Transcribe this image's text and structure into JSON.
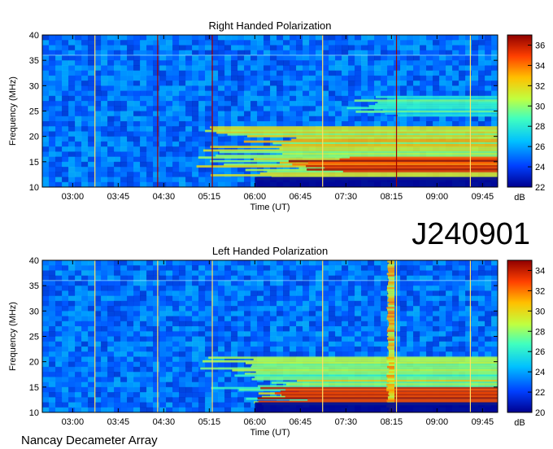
{
  "figure_id": "J240901",
  "footer": "Nancay Decameter Array",
  "chart_data": [
    {
      "type": "heatmap",
      "title": "Right Handed Polarization",
      "xlabel": "Time (UT)",
      "ylabel": "Frequency (MHz)",
      "x_ticks": [
        "03:00",
        "03:45",
        "04:30",
        "05:15",
        "06:00",
        "06:45",
        "07:30",
        "08:15",
        "09:00",
        "09:45"
      ],
      "x_range": [
        "02:30",
        "10:00"
      ],
      "y_ticks": [
        10,
        15,
        20,
        25,
        30,
        35,
        40
      ],
      "ylim": [
        10,
        40
      ],
      "colorbar": {
        "label": "dB",
        "min": 22,
        "max": 37,
        "ticks": [
          22,
          24,
          26,
          28,
          30,
          32,
          34,
          36
        ]
      },
      "colormap": [
        "#00008f",
        "#0040ff",
        "#00c0ff",
        "#40ffbf",
        "#c0ff40",
        "#ffc000",
        "#ff4000",
        "#8f0000"
      ],
      "background_level_db": 25,
      "vertical_lines_ut": [
        "03:22",
        "04:24",
        "05:18",
        "07:07",
        "08:20",
        "09:33"
      ],
      "emission": [
        {
          "band_mhz": [
            11.5,
            22
          ],
          "from_ut": "05:00",
          "to_ut": "10:00",
          "level_db": 31
        },
        {
          "band_mhz": [
            13,
            16
          ],
          "from_ut": "06:30",
          "to_ut": "10:00",
          "level_db": 36
        },
        {
          "band_mhz": [
            24,
            28
          ],
          "from_ut": "07:30",
          "to_ut": "10:00",
          "level_db": 28
        }
      ]
    },
    {
      "type": "heatmap",
      "title": "Left Handed Polarization",
      "xlabel": "Time (UT)",
      "ylabel": "Frequency (MHz)",
      "x_ticks": [
        "03:00",
        "03:45",
        "04:30",
        "05:15",
        "06:00",
        "06:45",
        "07:30",
        "08:15",
        "09:00",
        "09:45"
      ],
      "x_range": [
        "02:30",
        "10:00"
      ],
      "y_ticks": [
        10,
        15,
        20,
        25,
        30,
        35,
        40
      ],
      "ylim": [
        10,
        40
      ],
      "colorbar": {
        "label": "dB",
        "min": 20,
        "max": 35,
        "ticks": [
          20,
          22,
          24,
          26,
          28,
          30,
          32,
          34
        ]
      },
      "colormap": [
        "#00008f",
        "#0040ff",
        "#00c0ff",
        "#40ffbf",
        "#c0ff40",
        "#ffc000",
        "#ff4000",
        "#8f0000"
      ],
      "background_level_db": 23,
      "vertical_lines_ut": [
        "03:22",
        "04:24",
        "05:18",
        "07:07",
        "08:20",
        "09:33"
      ],
      "emission": [
        {
          "band_mhz": [
            11.5,
            21
          ],
          "from_ut": "05:00",
          "to_ut": "10:00",
          "level_db": 28
        },
        {
          "band_mhz": [
            12,
            15
          ],
          "from_ut": "06:00",
          "to_ut": "10:00",
          "level_db": 33
        },
        {
          "band_mhz": [
            10,
            40
          ],
          "from_ut": "08:10",
          "to_ut": "08:18",
          "level_db": 30
        }
      ]
    }
  ]
}
